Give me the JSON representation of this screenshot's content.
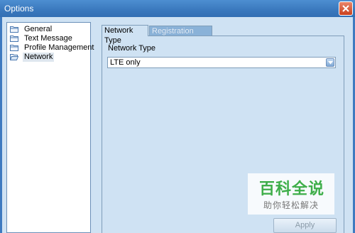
{
  "window": {
    "title": "Options",
    "close_icon": "close-icon"
  },
  "sidebar": {
    "items": [
      {
        "label": "General",
        "icon": "folder-icon",
        "selected": false
      },
      {
        "label": "Text Message",
        "icon": "folder-icon",
        "selected": false
      },
      {
        "label": "Profile Management",
        "icon": "folder-icon",
        "selected": false
      },
      {
        "label": "Network",
        "icon": "folder-open-icon",
        "selected": true
      }
    ]
  },
  "tabs": [
    {
      "label": "Network Type",
      "active": true
    },
    {
      "label": "Registration Mode",
      "active": false
    }
  ],
  "network_type": {
    "label": "Network Type",
    "selected": "LTE only"
  },
  "buttons": {
    "apply_label": "Apply"
  },
  "watermark": {
    "title": "百科全说",
    "subtitle": "助你轻松解决"
  },
  "colors": {
    "titlebar": "#3a78bd",
    "client_bg": "#cfe2f3",
    "watermark_green": "#3eae49"
  }
}
